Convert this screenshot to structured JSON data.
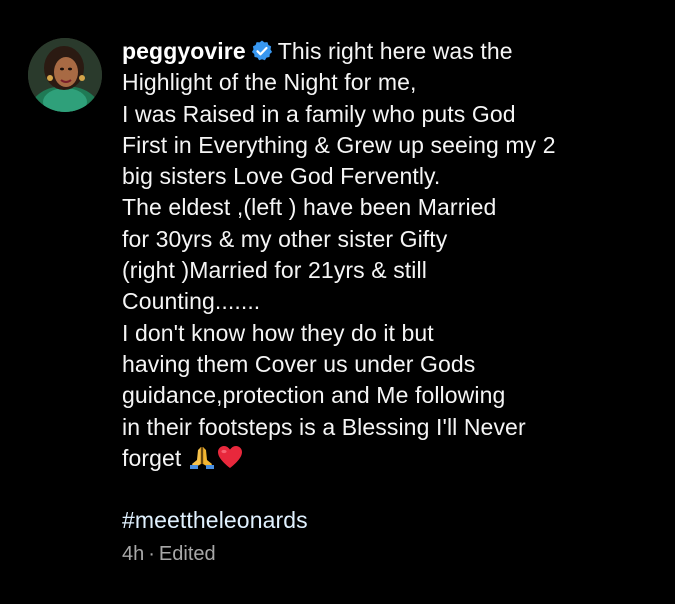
{
  "post": {
    "username": "peggyovire",
    "verified": true,
    "caption_first": "This right here was the",
    "caption_lines": [
      "Highlight of the Night for me,",
      "I was Raised in a family who puts God",
      "First in Everything & Grew up seeing my 2",
      "big sisters Love God Fervently.",
      "The eldest ,(left ) have been Married",
      "for 30yrs & my other sister Gifty",
      "(right )Married for 21yrs & still",
      "Counting.......",
      "I don't know how they do it but",
      "having them Cover us under Gods",
      "guidance,protection and Me following",
      "in their footsteps is a Blessing I'll Never"
    ],
    "caption_last": "forget",
    "emojis": [
      "folded-hands-icon",
      "red-heart-icon"
    ],
    "hashtag": "#meettheleonards",
    "time": "4h",
    "separator": "·",
    "edited": "Edited"
  },
  "colors": {
    "background": "#000000",
    "text": "#f5f5f5",
    "hashtag": "#e0f1ff",
    "meta": "#a8a8a8",
    "verified": "#3897f0"
  }
}
